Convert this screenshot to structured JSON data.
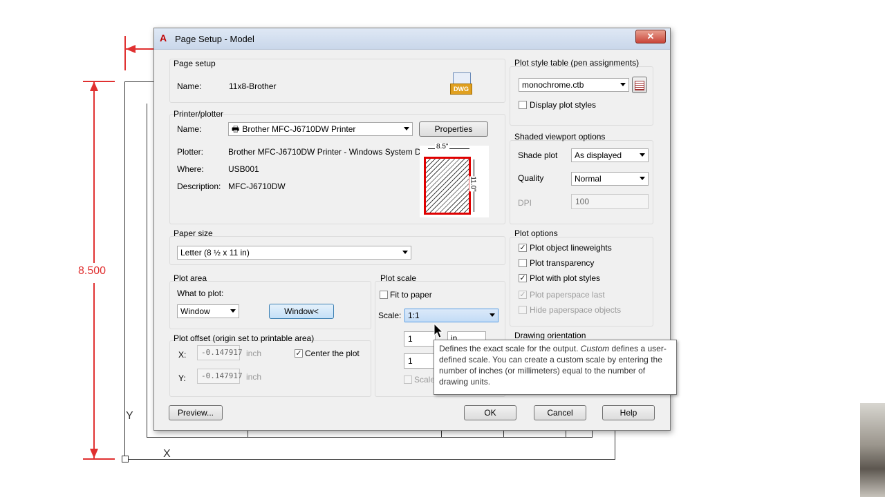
{
  "drawing": {
    "dimension_value": "8.500",
    "axis_y": "Y",
    "axis_x": "X"
  },
  "dialog": {
    "title": "Page Setup - Model",
    "close_icon": "close-icon",
    "page_setup": {
      "title": "Page setup",
      "name_label": "Name:",
      "name_value": "11x8-Brother",
      "dwg_icon_text": "DWG"
    },
    "printer": {
      "title": "Printer/plotter",
      "name_label": "Name:",
      "name_value": "Brother MFC-J6710DW Printer",
      "properties_label": "Properties",
      "plotter_label": "Plotter:",
      "plotter_value": "Brother MFC-J6710DW Printer - Windows System D...",
      "where_label": "Where:",
      "where_value": "USB001",
      "description_label": "Description:",
      "description_value": "MFC-J6710DW",
      "preview_width": "8.5\"",
      "preview_height": "11.0\""
    },
    "paper_size": {
      "title": "Paper size",
      "value": "Letter (8 ½ x 11 in)"
    },
    "plot_area": {
      "title": "Plot area",
      "what_label": "What to plot:",
      "what_value": "Window",
      "window_button": "Window<"
    },
    "plot_offset": {
      "title": "Plot offset (origin set to printable area)",
      "x_label": "X:",
      "x_value": "-0.147917",
      "x_unit": "inch",
      "y_label": "Y:",
      "y_value": "-0.147917",
      "y_unit": "inch",
      "center_label": "Center the plot",
      "center_checked": true
    },
    "plot_scale": {
      "title": "Plot scale",
      "fit_label": "Fit to paper",
      "scale_label": "Scale:",
      "scale_value": "1:1",
      "value1": "1",
      "value2": "1",
      "scale_lineweights_label": "Scale",
      "unit_partial": "in"
    },
    "plot_style_table": {
      "title": "Plot style table (pen assignments)",
      "value": "monochrome.ctb",
      "display_label": "Display plot styles"
    },
    "shaded": {
      "title": "Shaded viewport options",
      "shade_label": "Shade plot",
      "shade_value": "As displayed",
      "quality_label": "Quality",
      "quality_value": "Normal",
      "dpi_label": "DPI",
      "dpi_value": "100"
    },
    "plot_options": {
      "title": "Plot options",
      "items": [
        {
          "label": "Plot object lineweights",
          "checked": true
        },
        {
          "label": "Plot transparency",
          "checked": false
        },
        {
          "label": "Plot with plot styles",
          "checked": true
        },
        {
          "label": "Plot paperspace last",
          "checked": true
        },
        {
          "label": "Hide paperspace objects",
          "checked": false
        }
      ]
    },
    "drawing_orientation": {
      "title": "Drawing orientation"
    },
    "buttons": {
      "preview": "Preview...",
      "ok": "OK",
      "cancel": "Cancel",
      "help": "Help"
    }
  },
  "tooltip": {
    "pre": "Defines the exact scale for the output. ",
    "emph": "Custom",
    "post": " defines a user-defined scale. You can create a custom scale by entering the number of inches (or millimeters) equal to the number of drawing units."
  },
  "colors": {
    "dimension": "#e03030",
    "preview_border": "#e00000"
  }
}
